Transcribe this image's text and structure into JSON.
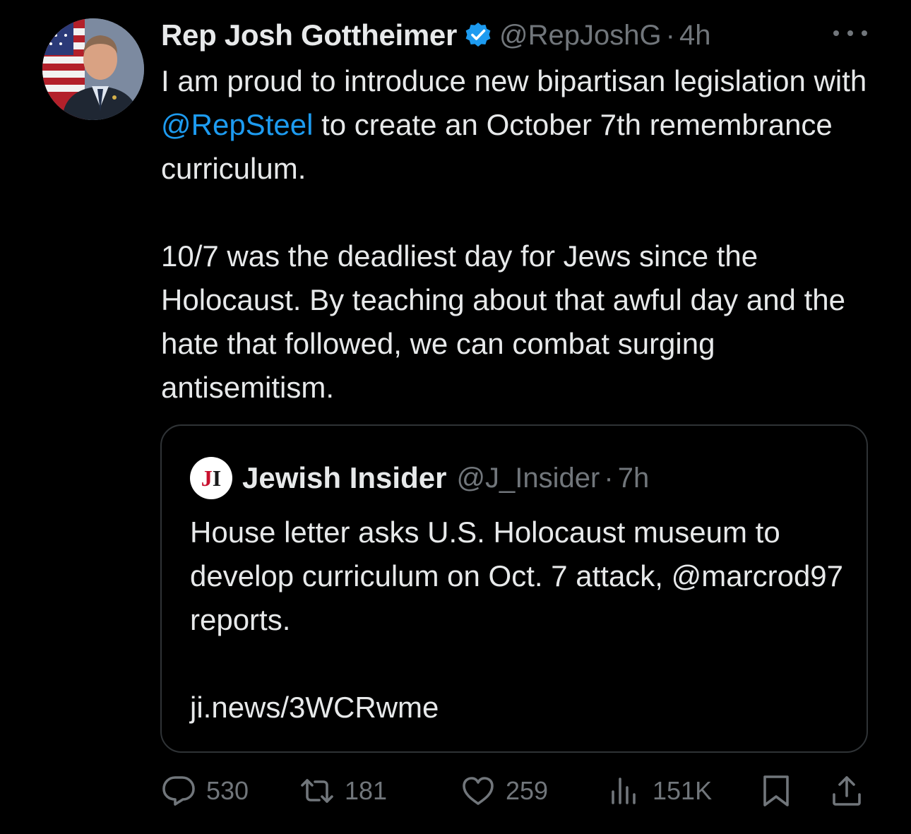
{
  "tweet": {
    "author": {
      "display_name": "Rep Josh Gottheimer",
      "handle": "@RepJoshG",
      "time_separator": "·",
      "time": "4h",
      "verified": true,
      "verified_color": "#1d9bf0"
    },
    "text": {
      "p1_before": "I am proud to introduce new bipartisan legislation with ",
      "p1_mention": "@RepSteel",
      "p1_after": " to create an October 7th remembrance curriculum.",
      "p2": "10/7 was the deadliest day for Jews since the Holocaust. By teaching about that awful day and the hate that followed, we can combat surging antisemitism."
    },
    "quote": {
      "logo_text_j": "J",
      "logo_text_i": "I",
      "display_name": "Jewish Insider",
      "handle": "@J_Insider",
      "time_separator": "·",
      "time": "7h",
      "p1": "House letter asks U.S. Holocaust museum to develop curriculum on Oct. 7 attack, @marcrod97 reports.",
      "p2": "ji.news/3WCRwme"
    },
    "actions": {
      "replies": "530",
      "reposts": "181",
      "likes": "259",
      "views": "151K"
    },
    "icons": [
      "more-icon",
      "verified-badge-icon",
      "reply-icon",
      "repost-icon",
      "like-icon",
      "views-icon",
      "bookmark-icon",
      "share-icon"
    ],
    "colors": {
      "background": "#000000",
      "text": "#e7e9ea",
      "secondary": "#71767b",
      "link": "#1d9bf0",
      "border": "#2f3336"
    }
  }
}
